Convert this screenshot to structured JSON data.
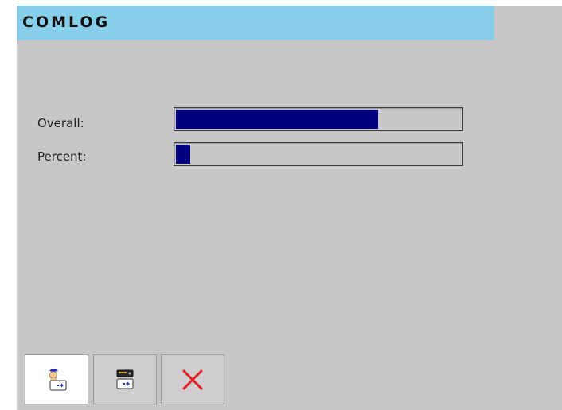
{
  "app": {
    "title": "COMLOG"
  },
  "progress": {
    "overall": {
      "label": "Overall:",
      "value_percent": 71
    },
    "percent": {
      "label": "Percent:",
      "value_percent": 5
    }
  },
  "toolbar": {
    "buttons": [
      {
        "icon": "user-transfer-icon",
        "active": true
      },
      {
        "icon": "device-transfer-icon",
        "active": false
      },
      {
        "icon": "close-icon",
        "active": false,
        "color": "#e02020"
      }
    ]
  },
  "colors": {
    "title_bar": "#87ceeb",
    "progress_fill": "#000080",
    "background": "#c8c6c9"
  }
}
